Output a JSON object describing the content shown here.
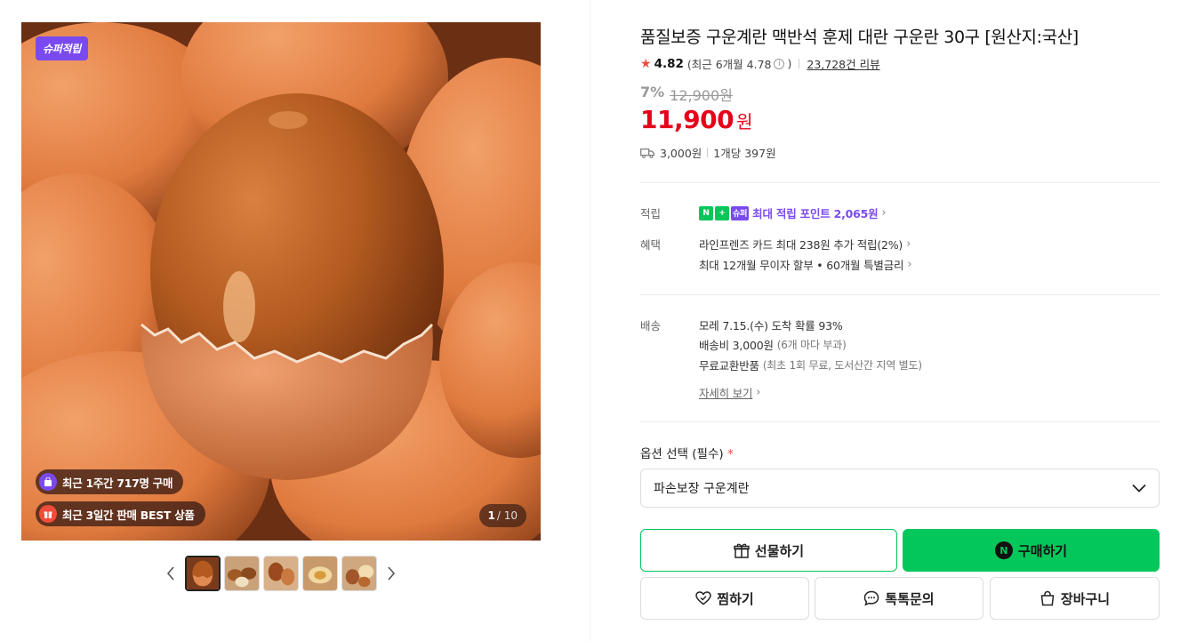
{
  "gallery": {
    "super_badge": "슈퍼적립",
    "pill_recent_buyers": "최근 1주간 717명 구매",
    "pill_best": "최근 3일간 판매 BEST 상품",
    "pager_current": "1",
    "pager_total": "/ 10",
    "thumbnail_count": 5
  },
  "product": {
    "title": "품질보증 구운계란 맥반석 훈제 대란 구운란 30구 [원산지:국산]",
    "rating": "4.82",
    "rating_recent": "(최근 6개월 4.78",
    "rating_close": ")",
    "review_count": "23,728건 리뷰",
    "discount_rate": "7%",
    "original_price": "12,900원",
    "price": "11,900",
    "price_unit": "원",
    "shipping_fee": "3,000원",
    "unit_price": "1개당 397원"
  },
  "benefits": {
    "points_label": "적립",
    "points_badge_n": "N",
    "points_badge_plus": "+",
    "points_badge_super": "슈퍼",
    "points_text": "최대 적립 포인트",
    "points_value": "2,065원",
    "benefit_label": "혜택",
    "benefit_line1": "라인프렌즈 카드 최대 238원 추가 적립(2%)",
    "benefit_line2": "최대 12개월 무이자 할부 • 60개월 특별금리"
  },
  "delivery": {
    "label": "배송",
    "arrival": "모레 7.15.(수) 도착 확률 93%",
    "fee_main": "배송비 3,000원",
    "fee_sub": "(6개 마다 부과)",
    "return_main": "무료교환반품",
    "return_sub": "(최초 1회 무료, 도서산간 지역 별도)",
    "more": "자세히 보기"
  },
  "options": {
    "label": "옵션 선택 (필수)",
    "required_mark": "*",
    "selected": "파손보장 구운계란"
  },
  "actions": {
    "gift": "선물하기",
    "buy": "구매하기",
    "buy_badge": "N",
    "wish": "찜하기",
    "talk": "톡톡문의",
    "cart": "장바구니"
  },
  "colors": {
    "accent_green": "#03c75a",
    "price_red": "#e6001a",
    "super_purple": "#7a4af0"
  }
}
